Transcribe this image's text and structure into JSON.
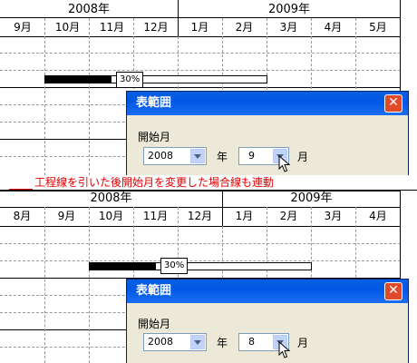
{
  "panel1": {
    "years": [
      "2008年",
      "2009年"
    ],
    "months": [
      "9月",
      "10月",
      "11月",
      "12月",
      "1月",
      "2月",
      "3月",
      "4月",
      "5月"
    ],
    "progress_label": "30%",
    "progress": 0.3
  },
  "caption": "工程線を引いた後開始月を変更した場合線も連動",
  "panel2": {
    "years": [
      "2008年",
      "2009年"
    ],
    "months": [
      "8月",
      "9月",
      "10月",
      "11月",
      "12月",
      "1月",
      "2月",
      "3月",
      "4月"
    ],
    "progress_label": "30%",
    "progress": 0.3
  },
  "dialog1": {
    "title": "表範囲",
    "group_label": "開始月",
    "year_value": "2008",
    "year_unit": "年",
    "month_value": "9",
    "month_unit": "月",
    "close_glyph": "✕"
  },
  "dialog2": {
    "title": "表範囲",
    "group_label": "開始月",
    "year_value": "2008",
    "year_unit": "年",
    "month_value": "8",
    "month_unit": "月",
    "close_glyph": "✕"
  },
  "colors": {
    "caption": "#e00000",
    "titlebar": "#0058e7",
    "dialog_bg": "#ece9d8",
    "close": "#e04a2a"
  }
}
